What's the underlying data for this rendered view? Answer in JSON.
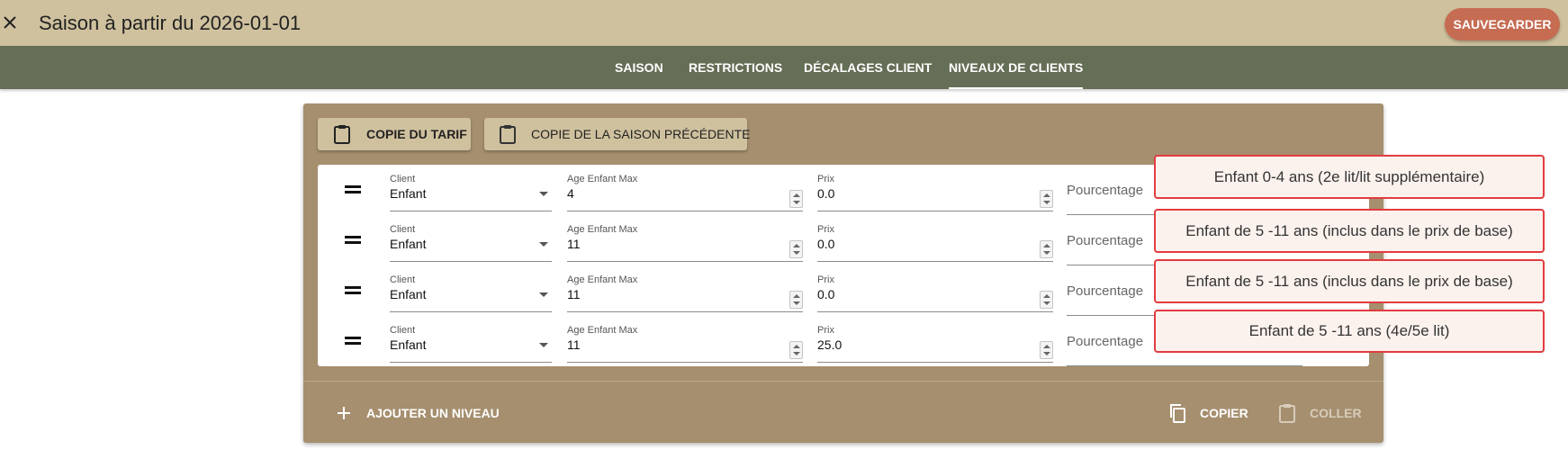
{
  "header": {
    "title": "Saison à partir du 2026-01-01",
    "save_label": "SAUVEGARDER"
  },
  "tabs": [
    {
      "label": "SAISON"
    },
    {
      "label": "RESTRICTIONS"
    },
    {
      "label": "DÉCALAGES CLIENT"
    },
    {
      "label": "NIVEAUX DE CLIENTS",
      "active": true
    }
  ],
  "panel": {
    "copy_rate_label": "COPIE DU TARIF",
    "copy_prev_season_label": "COPIE DE LA SAISON PRÉCÉDENTE",
    "add_level_label": "AJOUTER UN NIVEAU",
    "copy_label": "COPIER",
    "paste_label": "COLLER"
  },
  "field_labels": {
    "client": "Client",
    "age_max": "Age Enfant Max",
    "price": "Prix",
    "percentage": "Pourcentage"
  },
  "levels": [
    {
      "client": "Enfant",
      "age_max": "4",
      "price": "0.0",
      "note": "Enfant 0-4 ans (2e lit/lit supplémentaire)"
    },
    {
      "client": "Enfant",
      "age_max": "11",
      "price": "0.0",
      "note": "Enfant de 5 -11 ans (inclus dans le prix de base)"
    },
    {
      "client": "Enfant",
      "age_max": "11",
      "price": "0.0",
      "note": "Enfant de 5 -11 ans (inclus dans le prix de base)"
    },
    {
      "client": "Enfant",
      "age_max": "11",
      "price": "25.0",
      "note": "Enfant de 5 -11 ans (4e/5e lit)"
    }
  ],
  "colors": {
    "topbar": "#cfc19e",
    "tabbar": "#656e56",
    "panel": "#a68f6f",
    "save_button": "#c56c52",
    "note_border": "#e23c40"
  }
}
